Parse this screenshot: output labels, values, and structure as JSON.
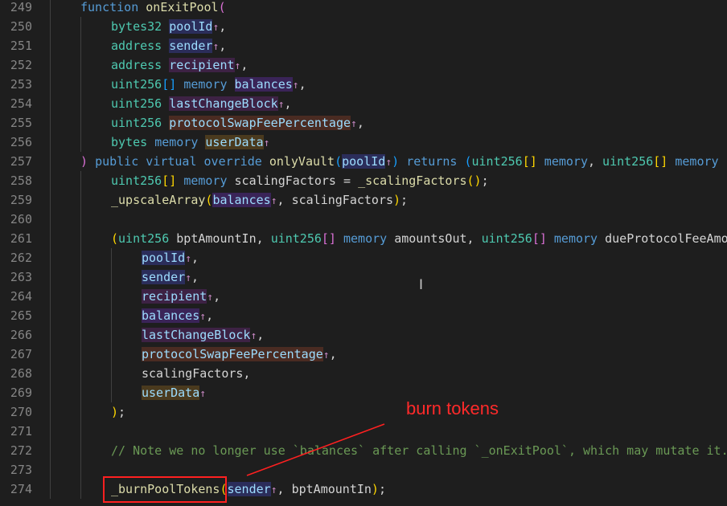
{
  "editor": {
    "lines": [
      {
        "n": "249",
        "indent": 1,
        "tokens": [
          [
            "kw",
            "function"
          ],
          [
            "pn",
            " "
          ],
          [
            "fn",
            "onExitPool"
          ],
          [
            "br2",
            "("
          ]
        ]
      },
      {
        "n": "250",
        "indent": 2,
        "tokens": [
          [
            "ty",
            "bytes32"
          ],
          [
            "pn",
            " "
          ],
          [
            "pm",
            "poolId",
            "hl-blue"
          ],
          [
            "ar",
            "↑"
          ],
          [
            "pn",
            ","
          ]
        ]
      },
      {
        "n": "251",
        "indent": 2,
        "tokens": [
          [
            "ty",
            "address"
          ],
          [
            "pn",
            " "
          ],
          [
            "pm",
            "sender",
            "hl-blue"
          ],
          [
            "ar",
            "↑"
          ],
          [
            "pn",
            ","
          ]
        ]
      },
      {
        "n": "252",
        "indent": 2,
        "tokens": [
          [
            "ty",
            "address"
          ],
          [
            "pn",
            " "
          ],
          [
            "pm",
            "recipient",
            "hl-plum"
          ],
          [
            "ar",
            "↑"
          ],
          [
            "pn",
            ","
          ]
        ]
      },
      {
        "n": "253",
        "indent": 2,
        "tokens": [
          [
            "ty",
            "uint256"
          ],
          [
            "br3",
            "[]"
          ],
          [
            "pn",
            " "
          ],
          [
            "kw",
            "memory"
          ],
          [
            "pn",
            " "
          ],
          [
            "pm",
            "balances",
            "hl-purple"
          ],
          [
            "ar",
            "↑"
          ],
          [
            "pn",
            ","
          ]
        ]
      },
      {
        "n": "254",
        "indent": 2,
        "tokens": [
          [
            "ty",
            "uint256"
          ],
          [
            "pn",
            " "
          ],
          [
            "pm",
            "lastChangeBlock",
            "hl-plum"
          ],
          [
            "ar",
            "↑"
          ],
          [
            "pn",
            ","
          ]
        ]
      },
      {
        "n": "255",
        "indent": 2,
        "tokens": [
          [
            "ty",
            "uint256"
          ],
          [
            "pn",
            " "
          ],
          [
            "pm",
            "protocolSwapFeePercentage",
            "hl-brown"
          ],
          [
            "ar",
            "↑"
          ],
          [
            "pn",
            ","
          ]
        ]
      },
      {
        "n": "256",
        "indent": 2,
        "tokens": [
          [
            "ty",
            "bytes"
          ],
          [
            "pn",
            " "
          ],
          [
            "kw",
            "memory"
          ],
          [
            "pn",
            " "
          ],
          [
            "pm",
            "userData",
            "hl-olive"
          ],
          [
            "ar",
            "↑"
          ]
        ]
      },
      {
        "n": "257",
        "indent": 1,
        "tokens": [
          [
            "br2",
            ")"
          ],
          [
            "pn",
            " "
          ],
          [
            "kw",
            "public"
          ],
          [
            "pn",
            " "
          ],
          [
            "kw",
            "virtual"
          ],
          [
            "pn",
            " "
          ],
          [
            "kw",
            "override"
          ],
          [
            "pn",
            " "
          ],
          [
            "fn",
            "onlyVault"
          ],
          [
            "br3",
            "("
          ],
          [
            "pm",
            "poolId",
            "hl-blue"
          ],
          [
            "ar",
            "↑"
          ],
          [
            "br3",
            ")"
          ],
          [
            "pn",
            " "
          ],
          [
            "kw",
            "returns"
          ],
          [
            "pn",
            " "
          ],
          [
            "br3",
            "("
          ],
          [
            "ty",
            "uint256"
          ],
          [
            "br1",
            "[]"
          ],
          [
            "pn",
            " "
          ],
          [
            "kw",
            "memory"
          ],
          [
            "pn",
            ", "
          ],
          [
            "ty",
            "uint256"
          ],
          [
            "br1",
            "[]"
          ],
          [
            "pn",
            " "
          ],
          [
            "kw",
            "memory"
          ]
        ]
      },
      {
        "n": "258",
        "indent": 2,
        "tokens": [
          [
            "ty",
            "uint256"
          ],
          [
            "br1",
            "[]"
          ],
          [
            "pn",
            " "
          ],
          [
            "kw",
            "memory"
          ],
          [
            "pn",
            " scalingFactors = "
          ],
          [
            "fn",
            "_scalingFactors"
          ],
          [
            "br1",
            "()"
          ],
          [
            "pn",
            ";"
          ]
        ]
      },
      {
        "n": "259",
        "indent": 2,
        "tokens": [
          [
            "fn",
            "_upscaleArray"
          ],
          [
            "br1",
            "("
          ],
          [
            "pm",
            "balances",
            "hl-purple"
          ],
          [
            "ar",
            "↑"
          ],
          [
            "pn",
            ", scalingFactors"
          ],
          [
            "br1",
            ")"
          ],
          [
            "pn",
            ";"
          ]
        ]
      },
      {
        "n": "260",
        "indent": 2,
        "tokens": []
      },
      {
        "n": "261",
        "indent": 2,
        "tokens": [
          [
            "br1",
            "("
          ],
          [
            "ty",
            "uint256"
          ],
          [
            "pn",
            " bptAmountIn, "
          ],
          [
            "ty",
            "uint256"
          ],
          [
            "br2",
            "[]"
          ],
          [
            "pn",
            " "
          ],
          [
            "kw",
            "memory"
          ],
          [
            "pn",
            " amountsOut, "
          ],
          [
            "ty",
            "uint256"
          ],
          [
            "br2",
            "[]"
          ],
          [
            "pn",
            " "
          ],
          [
            "kw",
            "memory"
          ],
          [
            "pn",
            " dueProtocolFeeAmounts"
          ]
        ]
      },
      {
        "n": "262",
        "indent": 3,
        "tokens": [
          [
            "pm",
            "poolId",
            "hl-blue"
          ],
          [
            "ar",
            "↑"
          ],
          [
            "pn",
            ","
          ]
        ]
      },
      {
        "n": "263",
        "indent": 3,
        "tokens": [
          [
            "pm",
            "sender",
            "hl-blue"
          ],
          [
            "ar",
            "↑"
          ],
          [
            "pn",
            ","
          ]
        ]
      },
      {
        "n": "264",
        "indent": 3,
        "tokens": [
          [
            "pm",
            "recipient",
            "hl-plum"
          ],
          [
            "ar",
            "↑"
          ],
          [
            "pn",
            ","
          ]
        ]
      },
      {
        "n": "265",
        "indent": 3,
        "tokens": [
          [
            "pm",
            "balances",
            "hl-purple"
          ],
          [
            "ar",
            "↑"
          ],
          [
            "pn",
            ","
          ]
        ]
      },
      {
        "n": "266",
        "indent": 3,
        "tokens": [
          [
            "pm",
            "lastChangeBlock",
            "hl-plum"
          ],
          [
            "ar",
            "↑"
          ],
          [
            "pn",
            ","
          ]
        ]
      },
      {
        "n": "267",
        "indent": 3,
        "tokens": [
          [
            "pm",
            "protocolSwapFeePercentage",
            "hl-brown"
          ],
          [
            "ar",
            "↑"
          ],
          [
            "pn",
            ","
          ]
        ]
      },
      {
        "n": "268",
        "indent": 3,
        "tokens": [
          [
            "pn",
            "scalingFactors,"
          ]
        ]
      },
      {
        "n": "269",
        "indent": 3,
        "tokens": [
          [
            "pm",
            "userData",
            "hl-olive"
          ],
          [
            "ar",
            "↑"
          ]
        ]
      },
      {
        "n": "270",
        "indent": 2,
        "tokens": [
          [
            "br1",
            ")"
          ],
          [
            "pn",
            ";"
          ]
        ]
      },
      {
        "n": "271",
        "indent": 2,
        "tokens": []
      },
      {
        "n": "272",
        "indent": 2,
        "tokens": [
          [
            "cm",
            "// Note we no longer use `balances` after calling `_onExitPool`, which may mutate it."
          ]
        ]
      },
      {
        "n": "273",
        "indent": 2,
        "tokens": []
      },
      {
        "n": "274",
        "indent": 2,
        "tokens": [
          [
            "fn",
            "_burnPoolTokens"
          ],
          [
            "br1",
            "("
          ],
          [
            "pm",
            "sender",
            "hl-blue"
          ],
          [
            "ar",
            "↑"
          ],
          [
            "pn",
            ", bptAmountIn"
          ],
          [
            "br1",
            ")"
          ],
          [
            "pn",
            ";"
          ]
        ]
      }
    ]
  },
  "annotation": {
    "label": "burn tokens",
    "color": "#ff2020"
  },
  "cursor": {
    "icon": "text-cursor-icon"
  }
}
